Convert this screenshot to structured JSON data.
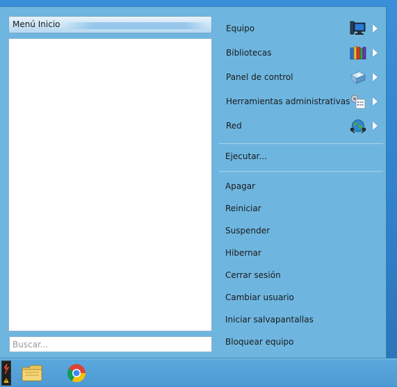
{
  "start_menu": {
    "title": "Menú Inicio",
    "search": {
      "placeholder": "Buscar..."
    },
    "nav_items": [
      {
        "label": "Equipo",
        "icon": "computer-icon"
      },
      {
        "label": "Bibliotecas",
        "icon": "libraries-icon"
      },
      {
        "label": "Panel de control",
        "icon": "control-panel-icon"
      },
      {
        "label": "Herramientas administrativas",
        "icon": "admin-tools-icon"
      },
      {
        "label": "Red",
        "icon": "network-icon"
      }
    ],
    "run": {
      "label": "Ejecutar..."
    },
    "power_items": [
      {
        "label": "Apagar"
      },
      {
        "label": "Reiniciar"
      },
      {
        "label": "Suspender"
      },
      {
        "label": "Hibernar"
      },
      {
        "label": "Cerrar sesión"
      },
      {
        "label": "Cambiar usuario"
      },
      {
        "label": "Iniciar salvapantallas"
      },
      {
        "label": "Bloquear equipo"
      }
    ]
  },
  "taskbar": {
    "items": [
      {
        "name": "start-button",
        "icon": "start-orb-icon"
      },
      {
        "name": "file-explorer",
        "icon": "folder-icon"
      },
      {
        "name": "chrome",
        "icon": "chrome-icon"
      }
    ]
  },
  "colors": {
    "menu_background": "#6eb6e0",
    "desktop_background": "#2f7fc9",
    "taskbar": "#4d9bd2"
  }
}
